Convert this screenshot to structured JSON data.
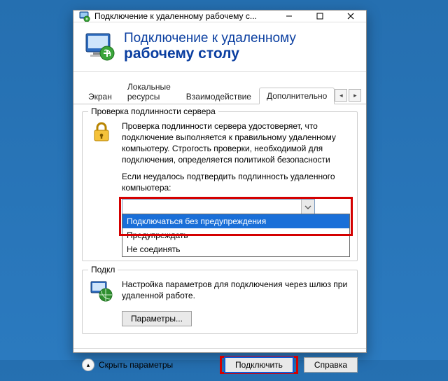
{
  "window": {
    "title": "Подключение к удаленному рабочему с..."
  },
  "header": {
    "line1": "Подключение к удаленному",
    "line2": "рабочему столу"
  },
  "tabs": {
    "items": [
      "Экран",
      "Локальные ресурсы",
      "Взаимодействие",
      "Дополнительно"
    ],
    "active_index": 3
  },
  "auth_group": {
    "title": "Проверка подлинности сервера",
    "desc": "Проверка подлинности сервера удостоверяет, что подключение выполняется к правильному удаленному компьютеру. Строгость проверки, необходимой для подключения, определяется политикой безопасности",
    "prompt": "Если неудалось подтвердить подлинность удаленного компьютера:",
    "combo": {
      "value": "Предупреждать",
      "options": [
        "Подключаться без предупреждения",
        "Предупреждать",
        "Не соединять"
      ],
      "selected_index": 0
    }
  },
  "gateway_group": {
    "title": "Подкл",
    "desc": "Настройка параметров для подключения через шлюз при удаленной работе.",
    "button": "Параметры..."
  },
  "footer": {
    "collapse": "Скрыть параметры",
    "connect": "Подключить",
    "help": "Справка"
  }
}
